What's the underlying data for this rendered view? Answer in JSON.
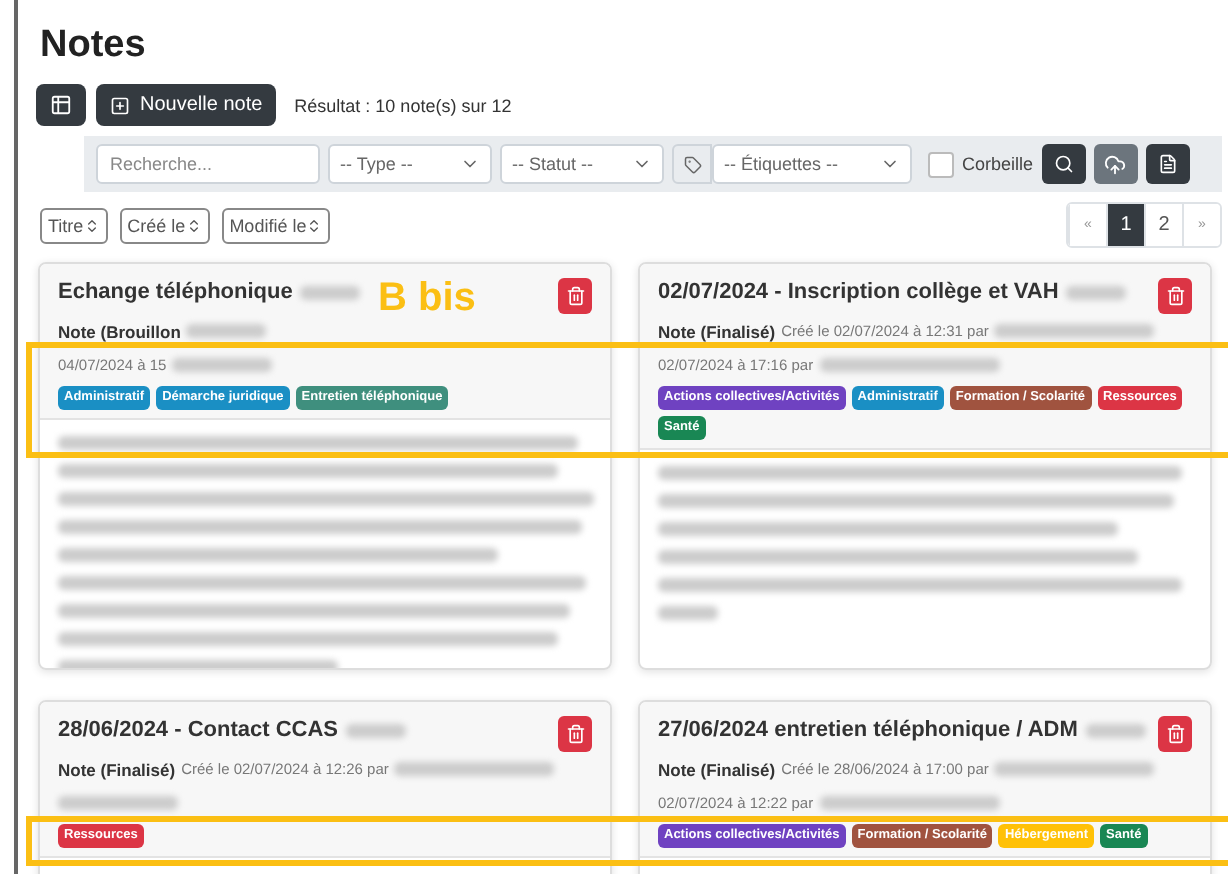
{
  "page_title": "Notes",
  "toolbar": {
    "new_button": "Nouvelle note",
    "result": "Résultat : 10 note(s) sur 12"
  },
  "filters": {
    "search_placeholder": "Recherche...",
    "type": "-- Type --",
    "status": "-- Statut --",
    "tags": "-- Étiquettes --",
    "trash": {
      "label": "Corbeille",
      "checked": false
    }
  },
  "sort_buttons": [
    "Titre",
    "Créé le",
    "Modifié le"
  ],
  "pagination": [
    {
      "label": "«",
      "selected": false,
      "kind": "arrow"
    },
    {
      "label": "1",
      "selected": true,
      "kind": "page"
    },
    {
      "label": "2",
      "selected": false,
      "kind": "page"
    },
    {
      "label": "»",
      "selected": false,
      "kind": "arrow"
    }
  ],
  "annotation_label": "B bis",
  "rows": [
    {
      "highlighted": true,
      "cards": [
        {
          "title": "Echange téléphonique",
          "status": "Note (Brouillon",
          "second_line": "04/07/2024 à 15",
          "tags": [
            {
              "label": "Administratif",
              "color": "#1a8fc4"
            },
            {
              "label": "Démarche juridique",
              "color": "#1a8fc4"
            },
            {
              "label": "Entretien téléphonique",
              "color": "#3f8f7e"
            }
          ]
        },
        {
          "title": "02/07/2024 - Inscription collège et VAH",
          "status": "Note (Finalisé)",
          "created": "Créé le 02/07/2024 à 12:31 par",
          "second_line": "02/07/2024 à 17:16 par",
          "tags": [
            {
              "label": "Actions collectives/Activités",
              "color": "#6f42c1"
            },
            {
              "label": "Administratif",
              "color": "#1a8fc4"
            },
            {
              "label": "Formation / Scolarité",
              "color": "#a0533f"
            },
            {
              "label": "Ressources",
              "color": "#dc3545"
            },
            {
              "label": "Santé",
              "color": "#198754"
            }
          ]
        }
      ]
    },
    {
      "highlighted": true,
      "cards": [
        {
          "title": "28/06/2024 - Contact CCAS",
          "status": "Note (Finalisé)",
          "created": "Créé le 02/07/2024 à 12:26 par",
          "tags": [
            {
              "label": "Ressources",
              "color": "#dc3545"
            }
          ]
        },
        {
          "title": "27/06/2024 entretien téléphonique / ADM",
          "status": "Note (Finalisé)",
          "created": "Créé le 28/06/2024 à 17:00 par",
          "second_line": "02/07/2024 à 12:22 par",
          "tags": [
            {
              "label": "Actions collectives/Activités",
              "color": "#6f42c1"
            },
            {
              "label": "Formation / Scolarité",
              "color": "#a0533f"
            },
            {
              "label": "Hébergement",
              "color": "#ffc107"
            },
            {
              "label": "Santé",
              "color": "#198754"
            }
          ]
        }
      ]
    }
  ]
}
